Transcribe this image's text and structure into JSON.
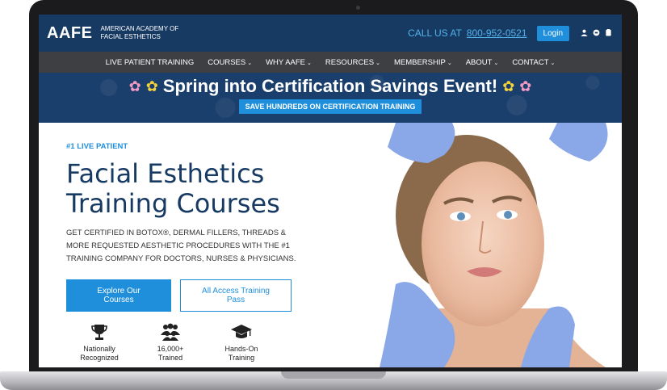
{
  "header": {
    "logo": "AAFE",
    "org_name": "AMERICAN ACADEMY OF FACIAL ESTHETICS",
    "call_label": "CALL US AT",
    "phone": "800-952-0521",
    "login_label": "Login",
    "icons": [
      "user-icon",
      "cart-icon",
      "account-icon"
    ]
  },
  "nav": {
    "items": [
      {
        "label": "LIVE PATIENT TRAINING",
        "dropdown": false
      },
      {
        "label": "COURSES",
        "dropdown": true
      },
      {
        "label": "WHY AAFE",
        "dropdown": true
      },
      {
        "label": "RESOURCES",
        "dropdown": true
      },
      {
        "label": "MEMBERSHIP",
        "dropdown": true
      },
      {
        "label": "ABOUT",
        "dropdown": true
      },
      {
        "label": "CONTACT",
        "dropdown": true
      }
    ]
  },
  "promo": {
    "title": "Spring into Certification Savings Event!",
    "button": "SAVE HUNDREDS ON CERTIFICATION TRAINING"
  },
  "hero": {
    "eyebrow": "#1 LIVE PATIENT",
    "title_line1": "Facial Esthetics",
    "title_line2": "Training Courses",
    "description": "GET CERTIFIED IN BOTOX®, DERMAL FILLERS, THREADS & MORE REQUESTED AESTHETIC PROCEDURES WITH THE #1 TRAINING COMPANY FOR DOCTORS, NURSES & PHYSICIANS.",
    "cta_primary": "Explore Our Courses",
    "cta_secondary": "All Access Training Pass",
    "features": [
      {
        "icon": "trophy-icon",
        "line1": "Nationally",
        "line2": "Recognized"
      },
      {
        "icon": "group-icon",
        "line1": "16,000+",
        "line2": "Trained"
      },
      {
        "icon": "graduation-cap-icon",
        "line1": "Hands-On",
        "line2": "Training"
      }
    ]
  },
  "colors": {
    "brand_navy": "#173a63",
    "accent_blue": "#1f8fdc",
    "nav_gray": "#3d3f43"
  }
}
